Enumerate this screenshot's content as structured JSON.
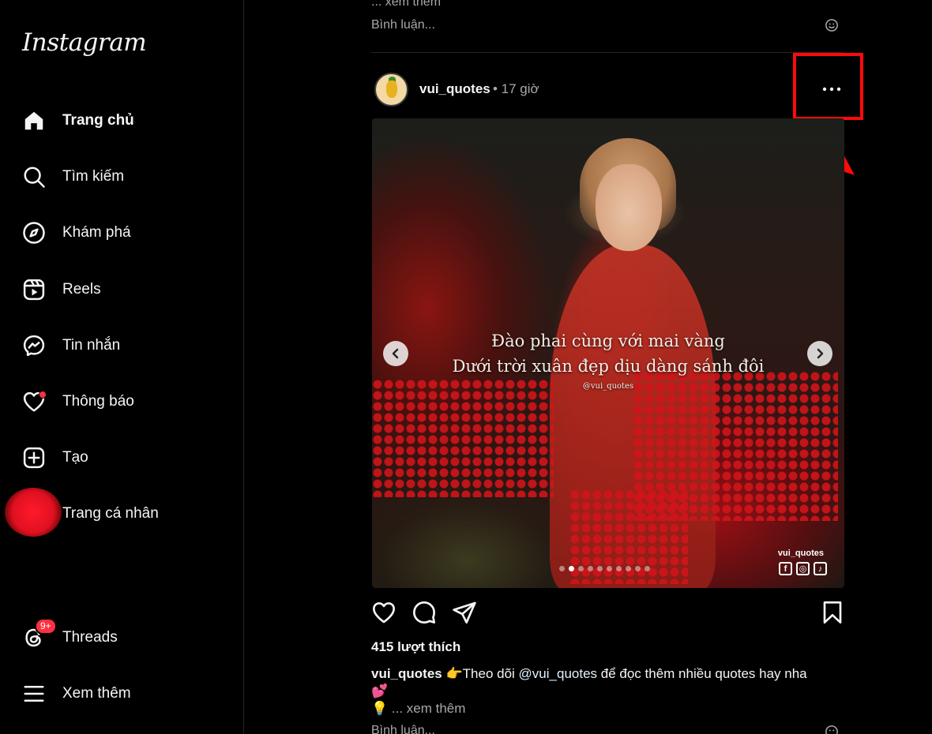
{
  "sidebar": {
    "logo": "Instagram",
    "items": [
      {
        "label": "Trang chủ",
        "icon": "home-icon"
      },
      {
        "label": "Tìm kiếm",
        "icon": "search-icon"
      },
      {
        "label": "Khám phá",
        "icon": "compass-icon"
      },
      {
        "label": "Reels",
        "icon": "reels-icon"
      },
      {
        "label": "Tin nhắn",
        "icon": "messenger-icon"
      },
      {
        "label": "Thông báo",
        "icon": "heart-icon"
      },
      {
        "label": "Tạo",
        "icon": "plus-square-icon"
      },
      {
        "label": "Trang cá nhân",
        "icon": "avatar"
      }
    ],
    "threads": {
      "label": "Threads",
      "badge": "9+"
    },
    "more": {
      "label": "Xem thêm"
    }
  },
  "previous_post": {
    "more_text": "... xem thêm",
    "comment_placeholder": "Bình luận..."
  },
  "post": {
    "username": "vui_quotes",
    "time": "• 17 giờ",
    "image": {
      "line1": "Đào phai cùng với mai vàng",
      "line2": "Dưới trời xuân đẹp dịu dàng sánh đôi",
      "handle": "@vui_quotes",
      "watermark": "vui_quotes",
      "slide_count": 10,
      "active_slide": 2
    },
    "likes": "415 lượt thích",
    "caption_user": "vui_quotes",
    "caption_pre": "👉Theo dõi ",
    "caption_mention": "@vui_quotes",
    "caption_post": " để đọc thêm nhiều quotes hay nha",
    "caption_line2": "💕",
    "more_text": "💡 ... xem thêm",
    "comment_placeholder": "Bình luận..."
  },
  "colors": {
    "highlight": "#ff0a0a",
    "badge": "#ff3040",
    "background": "#000000"
  }
}
